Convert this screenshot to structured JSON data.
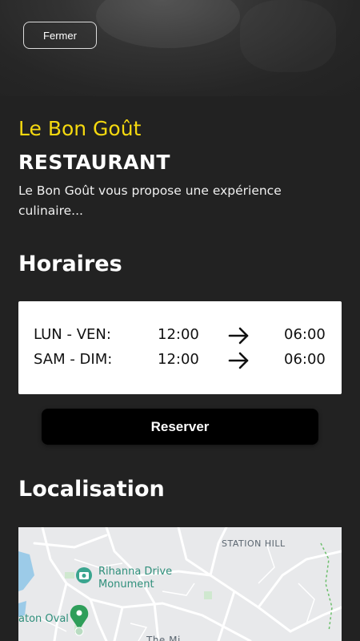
{
  "header": {
    "close_label": "Fermer"
  },
  "restaurant": {
    "name": "Le Bon Goût",
    "type": "RESTAURANT",
    "description": "Le Bon Goût vous propose une expérience culinaire..."
  },
  "hours": {
    "title": "Horaires",
    "rows": [
      {
        "days": "LUN - VEN:",
        "open": "12:00",
        "close": "06:00"
      },
      {
        "days": "SAM - DIM:",
        "open": "12:00",
        "close": "06:00"
      }
    ]
  },
  "actions": {
    "reserve_label": "Reserver"
  },
  "location": {
    "title": "Localisation",
    "map_labels": {
      "station": "STATION HILL",
      "monument_line1": "Rihanna Drive",
      "monument_line2": "Monument",
      "oval": "aton Oval",
      "bottom": "The Mi"
    }
  },
  "colors": {
    "background": "#222222",
    "accent_yellow": "#f5d90f",
    "card": "#ffffff",
    "button": "#000000"
  },
  "icons": {
    "arrow": "arrow-right-icon",
    "map_pin": "map-pin-icon",
    "camera": "camera-icon"
  }
}
